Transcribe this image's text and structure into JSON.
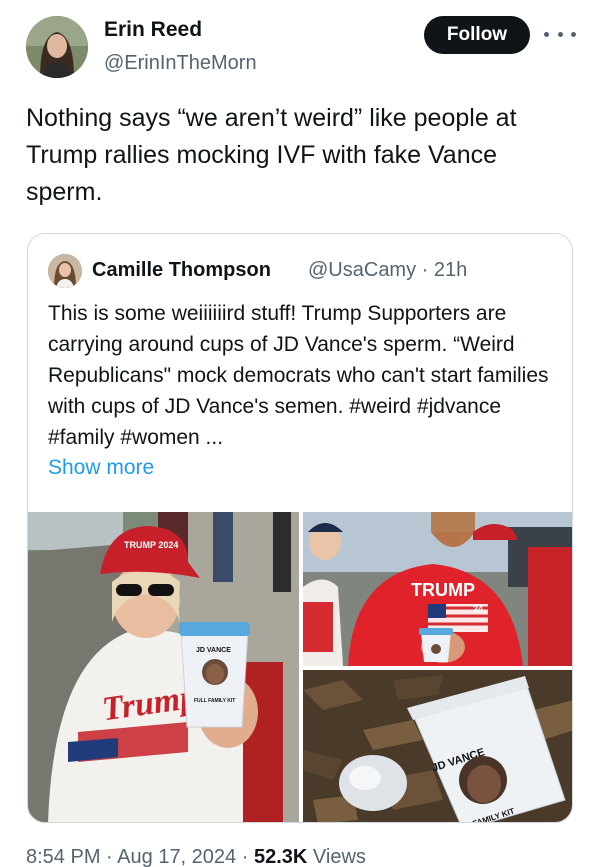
{
  "author": {
    "name": "Erin Reed",
    "handle": "@ErinInTheMorn",
    "avatar_icon": "profile-photo"
  },
  "follow_label": "Follow",
  "more_icon": "more-options-icon",
  "tweet_text": "Nothing says “we aren’t weird” like people at Trump rallies mocking IVF with fake Vance sperm.",
  "quoted": {
    "name": "Camille Thompson",
    "handle": "@UsaCamy",
    "separator": "·",
    "time": "21h",
    "text": "This is some weiiiiiird stuff! Trump Supporters are carrying around cups of JD Vance's sperm. “Weird Republicans\" mock democrats who can't start families with cups of JD Vance's semen. #weird #jdvance #family #women ...",
    "show_more": "Show more",
    "photos": {
      "p1_cup_label": "JD VANCE",
      "p1_cup_sub": "FULL FAMILY KIT",
      "p1_shirt": "Trump",
      "p1_hat": "TRUMP 2024",
      "p2_shirt": "TRUMP",
      "p2_shirt_num": "24",
      "p3_cup_label": "JD VANCE",
      "p3_cup_sub": "FAMILY KIT"
    }
  },
  "meta": {
    "time": "8:54 PM",
    "dot1": "·",
    "date": "Aug 17, 2024",
    "dot2": "·",
    "views_count": "52.3K",
    "views_label": "Views"
  },
  "colors": {
    "text": "#0f1419",
    "secondary": "#536471",
    "link": "#1d9bf0",
    "border": "#cfd9de"
  }
}
